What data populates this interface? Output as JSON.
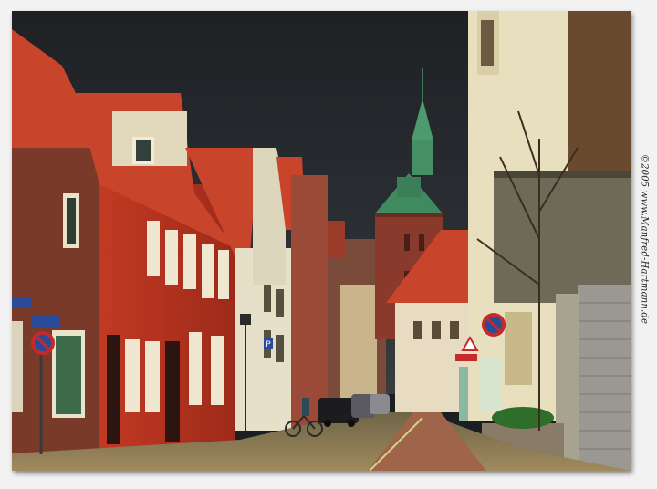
{
  "photo": {
    "subject": "street-scene",
    "watermark": "©2005 www.Manfred-Hartmann.de",
    "sign_text": "P"
  },
  "colors": {
    "sky": "#1f2226",
    "brick": "#b2321f",
    "roof": "#c8452c",
    "spire": "#3f8a5f",
    "cobble": "#8a7a5c"
  }
}
